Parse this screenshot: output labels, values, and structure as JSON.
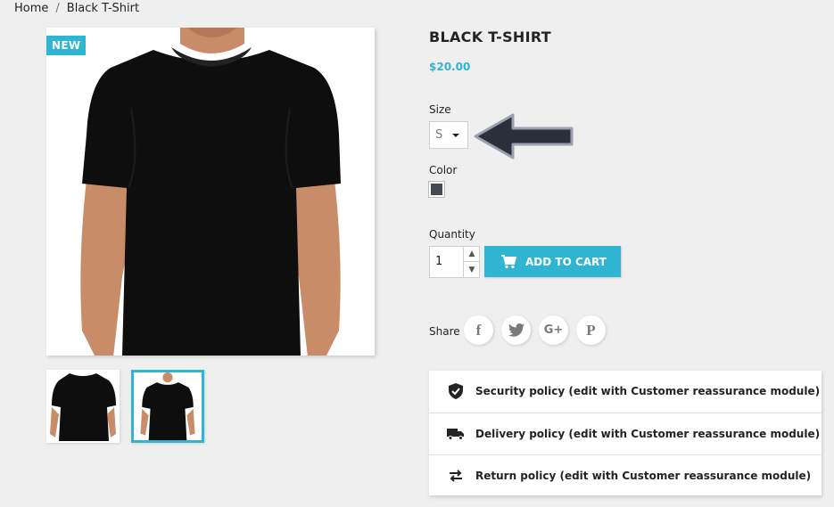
{
  "breadcrumb": {
    "home": "Home",
    "separator": "/",
    "current": "Black T-Shirt"
  },
  "product": {
    "badge": "NEW",
    "title": "BLACK T-SHIRT",
    "price": "$20.00",
    "size_label": "Size",
    "size_value": "S",
    "color_label": "Color",
    "color_swatch": "#434a54",
    "quantity_label": "Quantity",
    "quantity_value": "1",
    "add_to_cart": "ADD TO CART",
    "share_label": "Share"
  },
  "social": {
    "facebook": "f",
    "twitter": "twitter-icon",
    "googleplus": "G+",
    "pinterest": "P"
  },
  "reassurance": [
    {
      "icon": "shield-check-icon",
      "label": "Security policy (edit with Customer reassurance module)"
    },
    {
      "icon": "truck-icon",
      "label": "Delivery policy (edit with Customer reassurance module)"
    },
    {
      "icon": "swap-arrows-icon",
      "label": "Return policy (edit with Customer reassurance module)"
    }
  ],
  "colors": {
    "accent": "#2fb5d2",
    "text": "#232323",
    "background": "#efefef",
    "arrow": "#2b2f3a"
  }
}
